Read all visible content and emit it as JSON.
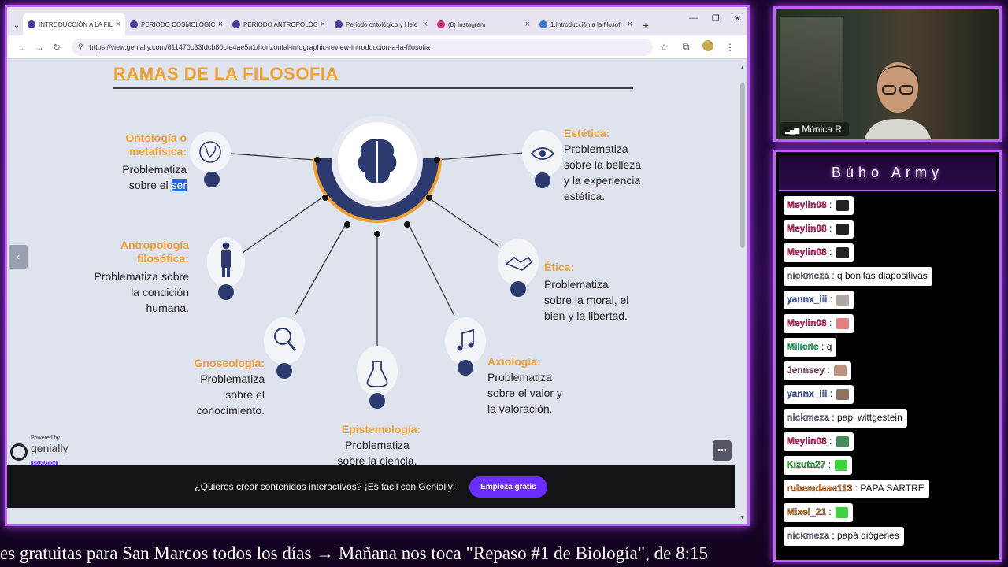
{
  "browser": {
    "tabs": [
      {
        "title": "INTRODUCCIÓN A LA FILO",
        "active": true
      },
      {
        "title": "PERIODO COSMOLÓGICO",
        "active": false
      },
      {
        "title": "PERIODO ANTROPOLÓGI",
        "active": false
      },
      {
        "title": "Periodo ontológico y Hele",
        "active": false
      },
      {
        "title": "(8) Instagram",
        "active": false
      },
      {
        "title": "1.Introducción a la filosofi",
        "active": false
      }
    ],
    "url": "https://view.genially.com/611470c33fdcb80cfe4ae5a1/horizontal-infographic-review-introduccion-a-la-filosofia"
  },
  "slide": {
    "title": "RAMAS DE LA FILOSOFIA",
    "branches": {
      "ontologia": {
        "title_1": "Ontología o",
        "title_2": "metafísica:",
        "text_1": "Problematiza",
        "text_2a": "sobre el ",
        "text_2b": "ser"
      },
      "antropologia": {
        "title_1": "Antropología",
        "title_2": "filosófica:",
        "text_1": "Problematiza sobre",
        "text_2": "la condición",
        "text_3": "humana."
      },
      "gnoseologia": {
        "title": "Gnoseología:",
        "text_1": "Problematiza",
        "text_2": "sobre el",
        "text_3": "conocimiento."
      },
      "epistemologia": {
        "title": "Epistemología:",
        "text_1": "Problematiza",
        "text_2": "sobre la ciencia."
      },
      "axiologia": {
        "title": "Axiología:",
        "text_1": "Problematiza",
        "text_2": "sobre el valor y",
        "text_3": "la valoración."
      },
      "etica": {
        "title": "Ética:",
        "text_1": "Problematiza",
        "text_2": "sobre la moral, el",
        "text_3": "bien y la libertad."
      },
      "estetica": {
        "title": "Estética:",
        "text_1": "Problematiza",
        "text_2": "sobre la belleza",
        "text_3": "y la experiencia",
        "text_4": "estética."
      }
    }
  },
  "genially": {
    "powered": "Powered by",
    "name": "genially",
    "badge": "EDUCATION",
    "cta_text": "¿Quieres crear contenidos interactivos? ¡Es fácil con Genially!",
    "cta_button": "Empieza gratis"
  },
  "webcam": {
    "name": "Mónica R."
  },
  "chat": {
    "title": "Búho Army",
    "messages": [
      {
        "user": "Meylin08",
        "color": "#d0206a",
        "text": "",
        "emote": "#222"
      },
      {
        "user": "Meylin08",
        "color": "#d0206a",
        "text": "",
        "emote": "#222"
      },
      {
        "user": "Meylin08",
        "color": "#d0206a",
        "text": "",
        "emote": "#222"
      },
      {
        "user": "nickmeza",
        "color": "#8888a0",
        "text": "q bonitas diapositivas",
        "emote": ""
      },
      {
        "user": "yannx_iii",
        "color": "#4a6ad0",
        "text": "",
        "emote": "#b0a8a0"
      },
      {
        "user": "Meylin08",
        "color": "#d0206a",
        "text": "",
        "emote": "#e08080"
      },
      {
        "user": "Milicite",
        "color": "#20c070",
        "text": "q",
        "emote": ""
      },
      {
        "user": "Jennsey",
        "color": "#9a6080",
        "text": "",
        "emote": "#c09080"
      },
      {
        "user": "yannx_iii",
        "color": "#4a6ad0",
        "text": "",
        "emote": "#907060"
      },
      {
        "user": "nickmeza",
        "color": "#8888a0",
        "text": "papi wittgestein",
        "emote": ""
      },
      {
        "user": "Meylin08",
        "color": "#d0206a",
        "text": "",
        "emote": "#4a8a60"
      },
      {
        "user": "Kizuta27",
        "color": "#30c030",
        "text": "",
        "emote": "#40d040"
      },
      {
        "user": "rubemdaaa113",
        "color": "#e08030",
        "text": "PAPA SARTRE",
        "emote": ""
      },
      {
        "user": "Mixel_21",
        "color": "#d07a20",
        "text": "",
        "emote": "#40d040"
      },
      {
        "user": "nickmeza",
        "color": "#8888a0",
        "text": "papá diógenes",
        "emote": ""
      }
    ]
  },
  "ticker": "es gratuitas para San Marcos todos los días → Mañana nos toca \"Repaso #1 de Biología\", de 8:15"
}
